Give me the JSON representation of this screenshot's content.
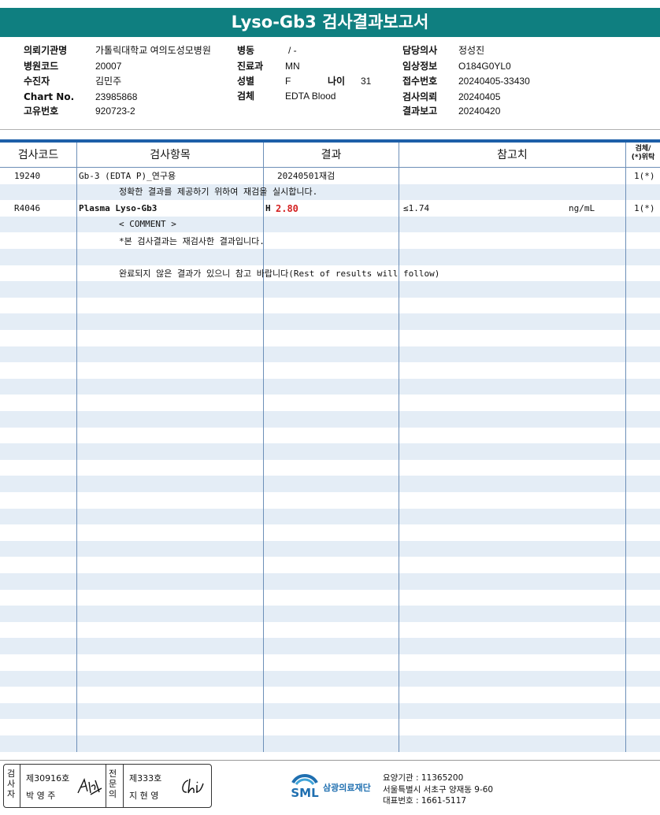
{
  "report": {
    "title": "Lyso-Gb3 검사결과보고서"
  },
  "info_left": [
    {
      "label": "의뢰기관명",
      "value": "가톨릭대학교 여의도성모병원"
    },
    {
      "label": "병원코드",
      "value": "20007"
    },
    {
      "label": "수진자",
      "value": "김민주"
    },
    {
      "label": "Chart No.",
      "value": "23985868"
    },
    {
      "label": "고유번호",
      "value": "920723-2"
    }
  ],
  "info_mid": [
    {
      "label": "병동",
      "value": "/ -"
    },
    {
      "label": "진료과",
      "value": "MN"
    },
    {
      "label": "성별",
      "value": "F"
    },
    {
      "label": "검체",
      "value": "EDTA Blood"
    }
  ],
  "info_age": {
    "label": "나이",
    "value": "31"
  },
  "info_right": [
    {
      "label": "담당의사",
      "value": "정성진"
    },
    {
      "label": "임상정보",
      "value": "O184G0YL0"
    },
    {
      "label": "접수번호",
      "value": "20240405-33430"
    },
    {
      "label": "검사의뢰",
      "value": "20240405"
    },
    {
      "label": "결과보고",
      "value": "20240420"
    }
  ],
  "table": {
    "headers": {
      "code": "검사코드",
      "item": "검사항목",
      "result": "결과",
      "reference": "참고치",
      "specimen_line1": "검체/",
      "specimen_line2": "(*)위탁"
    },
    "rows": [
      {
        "code": "19240",
        "item": "Gb-3 (EDTA P)_연구용",
        "result": "20240501재검",
        "reference": "",
        "unit": "",
        "specimen": "1(*)"
      },
      {
        "note": "정확한 결과를 제공하기 위하여 재검을 실시합니다."
      },
      {
        "code": "R4046",
        "item": "Plasma Lyso-Gb3",
        "flag": "H",
        "result": "2.80",
        "reference": "≤1.74",
        "unit": "ng/mL",
        "specimen": "1(*)"
      },
      {
        "note": "< COMMENT >"
      },
      {
        "note": "*본 검사결과는 재검사한 결과입니다."
      },
      {
        "note": ""
      },
      {
        "note": "완료되지  않은  결과가  있으니  참고  바랍니다(Rest of results will follow)"
      }
    ]
  },
  "footer": {
    "examiner_label": "검사자",
    "examiner_no": "제30916호",
    "examiner_name": "박 영 주",
    "reviewer_label": "전문의",
    "reviewer_no": "제333호",
    "reviewer_name": "지 현 영",
    "org_logo_text": "SML",
    "org_name": "삼광의료재단",
    "org_code": "요양기관 : 11365200",
    "org_address": "서울특별시 서초구 양재동 9-60",
    "org_phone": "대표번호 : 1661-5117"
  }
}
